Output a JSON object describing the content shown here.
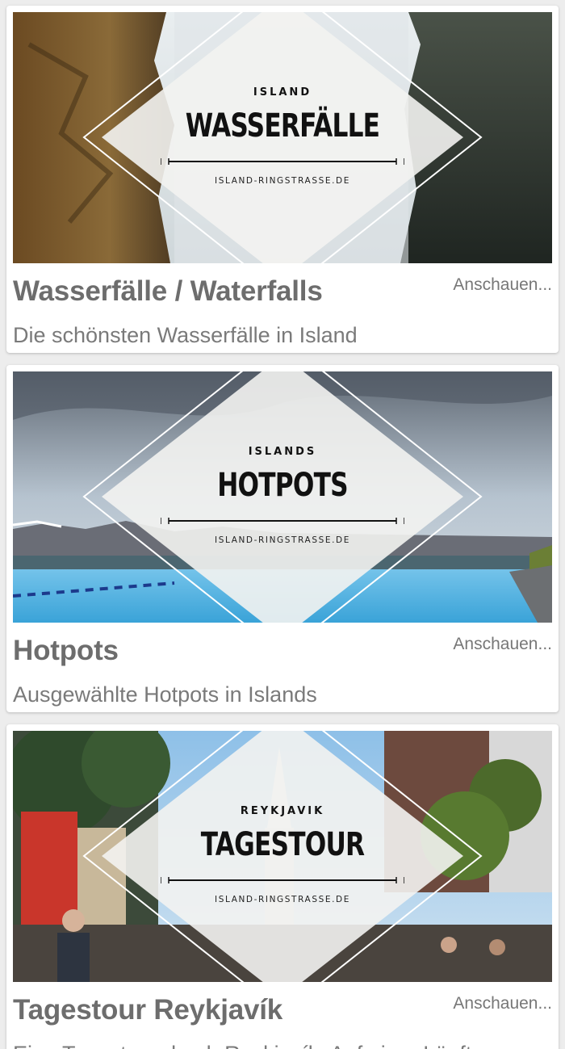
{
  "cards": [
    {
      "badge_kicker": "ISLAND",
      "badge_title": "WASSERFÄLLE",
      "badge_site": "ISLAND-RINGSTRASSE.DE",
      "title": "Wasserfälle / Waterfalls",
      "subtitle": "Die schönsten Wasserfälle in Island",
      "action": "Anschauen..."
    },
    {
      "badge_kicker": "ISLANDS",
      "badge_title": "HOTPOTS",
      "badge_site": "ISLAND-RINGSTRASSE.DE",
      "title": "Hotpots",
      "subtitle": "Ausgewählte Hotpots in Islands",
      "action": "Anschauen..."
    },
    {
      "badge_kicker": "REYKJAVIK",
      "badge_title": "TAGESTOUR",
      "badge_site": "ISLAND-RINGSTRASSE.DE",
      "title": "Tagestour Reykjavík",
      "subtitle": "Eine Tagestour durch Reykjavík. Auf einer Läuft",
      "action": "Anschauen..."
    }
  ]
}
